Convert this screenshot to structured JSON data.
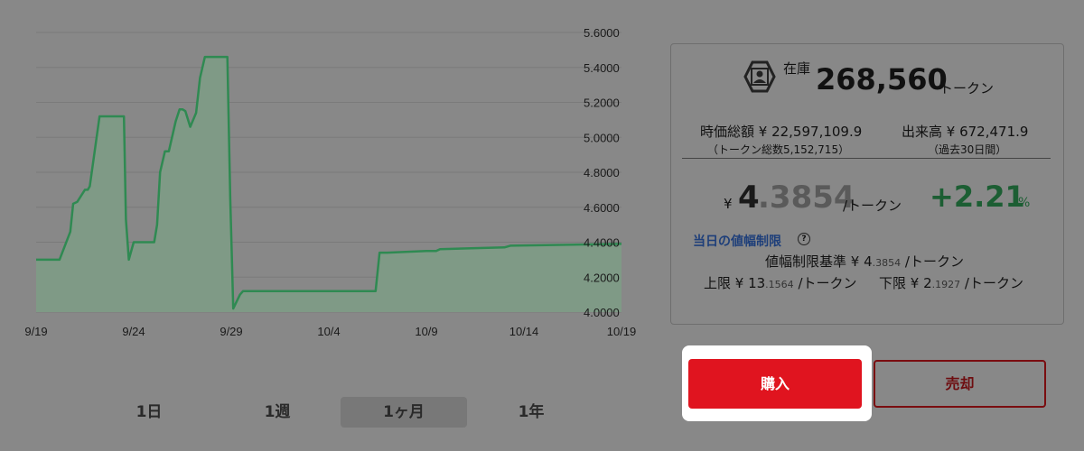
{
  "chart_data": {
    "type": "area",
    "x_labels": [
      "9/19",
      "9/24",
      "9/29",
      "10/4",
      "10/9",
      "10/14",
      "10/19"
    ],
    "ylim": [
      4.0,
      5.6
    ],
    "y_ticks": [
      "4.0000",
      "4.2000",
      "4.4000",
      "4.6000",
      "4.8000",
      "5.0000",
      "5.2000",
      "5.4000",
      "5.6000"
    ],
    "grid": true,
    "color": "#2f8a52",
    "fill": "#7f9a86",
    "series": [
      {
        "x": [
          0,
          1.2,
          1.75,
          1.9,
          2.1,
          2.5,
          2.65,
          2.75,
          3.25,
          4.5,
          4.6,
          4.75,
          5.0,
          6.05,
          6.2,
          6.35,
          6.6,
          6.8,
          7.15,
          7.35,
          7.5,
          7.65,
          7.9,
          8.2,
          8.4,
          8.65,
          8.95,
          9.8,
          9.95,
          10.1,
          10.45,
          10.6,
          11.5,
          11.65,
          12.0,
          12.25,
          14.6,
          15.5,
          15.6,
          17.4,
          17.6,
          18.0,
          20.0,
          20.5,
          20.7,
          24.0,
          24.3,
          30.0
        ],
        "y": [
          4.3,
          4.3,
          4.46,
          4.62,
          4.63,
          4.7,
          4.7,
          4.72,
          5.12,
          5.12,
          4.53,
          4.3,
          4.4,
          4.4,
          4.5,
          4.8,
          4.92,
          4.92,
          5.09,
          5.16,
          5.16,
          5.15,
          5.06,
          5.14,
          5.34,
          5.46,
          5.46,
          5.46,
          4.65,
          4.02,
          4.1,
          4.12,
          4.12,
          4.12,
          4.12,
          4.12,
          4.12,
          4.12,
          4.12,
          4.12,
          4.34,
          4.34,
          4.35,
          4.35,
          4.36,
          4.37,
          4.38,
          4.39
        ]
      }
    ]
  },
  "tabs": [
    {
      "label": "1日",
      "active": false
    },
    {
      "label": "1週",
      "active": false
    },
    {
      "label": "1ヶ月",
      "active": true
    },
    {
      "label": "1年",
      "active": false
    }
  ],
  "panel": {
    "stock_label": "在庫",
    "stock_value": "268,560",
    "stock_unit": "トークン",
    "market_cap_label": "時価総額 ¥ 22,597,109.9",
    "market_cap_sub": "（トークン総数5,152,715）",
    "volume_label": "出来高 ¥ 672,471.9",
    "volume_sub": "（過去30日間）",
    "price_yen": "¥",
    "price_int": "4",
    "price_dec": ".3854",
    "price_unit": "/トークン",
    "change": "+2.21",
    "change_pct": "%",
    "limit_title": "当日の値幅制限",
    "help_icon": "?",
    "base_label": "値幅制限基準 ¥ 4",
    "base_dec": ".3854",
    "base_unit": "/トークン",
    "upper_label": "上限 ¥ 13",
    "upper_dec": ".1564",
    "upper_unit": "/トークン",
    "lower_label": "下限 ¥ 2",
    "lower_dec": ".1927",
    "lower_unit": "/トークン"
  },
  "actions": {
    "buy_label": "購入",
    "sell_label": "売却"
  }
}
